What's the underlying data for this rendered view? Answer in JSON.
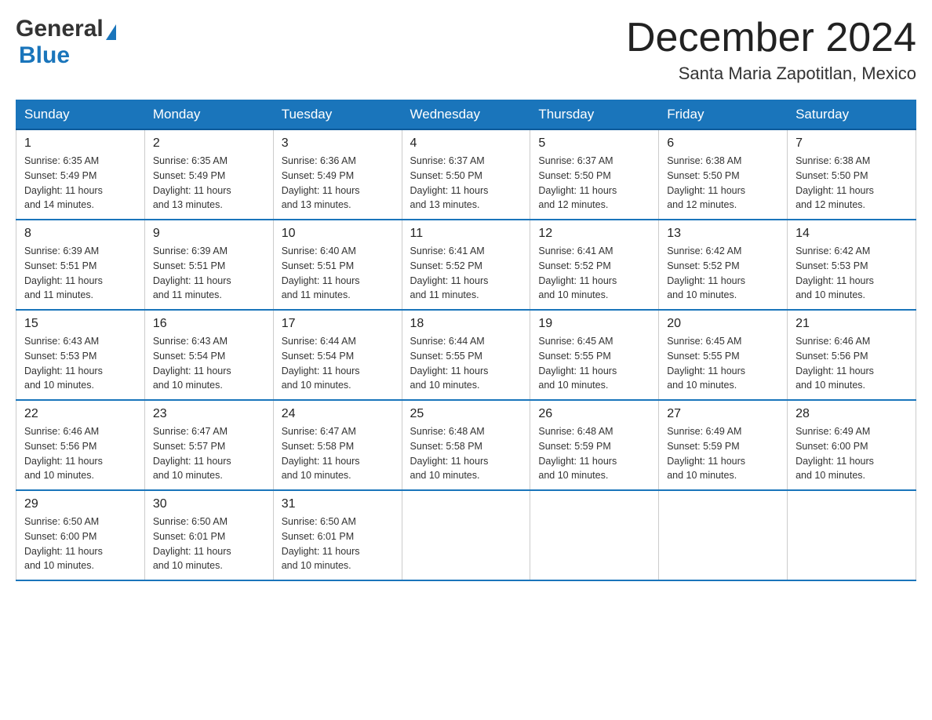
{
  "header": {
    "logo_general": "General",
    "logo_blue": "Blue",
    "month_title": "December 2024",
    "location": "Santa Maria Zapotitlan, Mexico"
  },
  "days_of_week": [
    "Sunday",
    "Monday",
    "Tuesday",
    "Wednesday",
    "Thursday",
    "Friday",
    "Saturday"
  ],
  "weeks": [
    [
      {
        "day": "1",
        "sunrise": "6:35 AM",
        "sunset": "5:49 PM",
        "daylight": "11 hours and 14 minutes."
      },
      {
        "day": "2",
        "sunrise": "6:35 AM",
        "sunset": "5:49 PM",
        "daylight": "11 hours and 13 minutes."
      },
      {
        "day": "3",
        "sunrise": "6:36 AM",
        "sunset": "5:49 PM",
        "daylight": "11 hours and 13 minutes."
      },
      {
        "day": "4",
        "sunrise": "6:37 AM",
        "sunset": "5:50 PM",
        "daylight": "11 hours and 13 minutes."
      },
      {
        "day": "5",
        "sunrise": "6:37 AM",
        "sunset": "5:50 PM",
        "daylight": "11 hours and 12 minutes."
      },
      {
        "day": "6",
        "sunrise": "6:38 AM",
        "sunset": "5:50 PM",
        "daylight": "11 hours and 12 minutes."
      },
      {
        "day": "7",
        "sunrise": "6:38 AM",
        "sunset": "5:50 PM",
        "daylight": "11 hours and 12 minutes."
      }
    ],
    [
      {
        "day": "8",
        "sunrise": "6:39 AM",
        "sunset": "5:51 PM",
        "daylight": "11 hours and 11 minutes."
      },
      {
        "day": "9",
        "sunrise": "6:39 AM",
        "sunset": "5:51 PM",
        "daylight": "11 hours and 11 minutes."
      },
      {
        "day": "10",
        "sunrise": "6:40 AM",
        "sunset": "5:51 PM",
        "daylight": "11 hours and 11 minutes."
      },
      {
        "day": "11",
        "sunrise": "6:41 AM",
        "sunset": "5:52 PM",
        "daylight": "11 hours and 11 minutes."
      },
      {
        "day": "12",
        "sunrise": "6:41 AM",
        "sunset": "5:52 PM",
        "daylight": "11 hours and 10 minutes."
      },
      {
        "day": "13",
        "sunrise": "6:42 AM",
        "sunset": "5:52 PM",
        "daylight": "11 hours and 10 minutes."
      },
      {
        "day": "14",
        "sunrise": "6:42 AM",
        "sunset": "5:53 PM",
        "daylight": "11 hours and 10 minutes."
      }
    ],
    [
      {
        "day": "15",
        "sunrise": "6:43 AM",
        "sunset": "5:53 PM",
        "daylight": "11 hours and 10 minutes."
      },
      {
        "day": "16",
        "sunrise": "6:43 AM",
        "sunset": "5:54 PM",
        "daylight": "11 hours and 10 minutes."
      },
      {
        "day": "17",
        "sunrise": "6:44 AM",
        "sunset": "5:54 PM",
        "daylight": "11 hours and 10 minutes."
      },
      {
        "day": "18",
        "sunrise": "6:44 AM",
        "sunset": "5:55 PM",
        "daylight": "11 hours and 10 minutes."
      },
      {
        "day": "19",
        "sunrise": "6:45 AM",
        "sunset": "5:55 PM",
        "daylight": "11 hours and 10 minutes."
      },
      {
        "day": "20",
        "sunrise": "6:45 AM",
        "sunset": "5:55 PM",
        "daylight": "11 hours and 10 minutes."
      },
      {
        "day": "21",
        "sunrise": "6:46 AM",
        "sunset": "5:56 PM",
        "daylight": "11 hours and 10 minutes."
      }
    ],
    [
      {
        "day": "22",
        "sunrise": "6:46 AM",
        "sunset": "5:56 PM",
        "daylight": "11 hours and 10 minutes."
      },
      {
        "day": "23",
        "sunrise": "6:47 AM",
        "sunset": "5:57 PM",
        "daylight": "11 hours and 10 minutes."
      },
      {
        "day": "24",
        "sunrise": "6:47 AM",
        "sunset": "5:58 PM",
        "daylight": "11 hours and 10 minutes."
      },
      {
        "day": "25",
        "sunrise": "6:48 AM",
        "sunset": "5:58 PM",
        "daylight": "11 hours and 10 minutes."
      },
      {
        "day": "26",
        "sunrise": "6:48 AM",
        "sunset": "5:59 PM",
        "daylight": "11 hours and 10 minutes."
      },
      {
        "day": "27",
        "sunrise": "6:49 AM",
        "sunset": "5:59 PM",
        "daylight": "11 hours and 10 minutes."
      },
      {
        "day": "28",
        "sunrise": "6:49 AM",
        "sunset": "6:00 PM",
        "daylight": "11 hours and 10 minutes."
      }
    ],
    [
      {
        "day": "29",
        "sunrise": "6:50 AM",
        "sunset": "6:00 PM",
        "daylight": "11 hours and 10 minutes."
      },
      {
        "day": "30",
        "sunrise": "6:50 AM",
        "sunset": "6:01 PM",
        "daylight": "11 hours and 10 minutes."
      },
      {
        "day": "31",
        "sunrise": "6:50 AM",
        "sunset": "6:01 PM",
        "daylight": "11 hours and 10 minutes."
      },
      null,
      null,
      null,
      null
    ]
  ],
  "labels": {
    "sunrise": "Sunrise:",
    "sunset": "Sunset:",
    "daylight": "Daylight:"
  }
}
